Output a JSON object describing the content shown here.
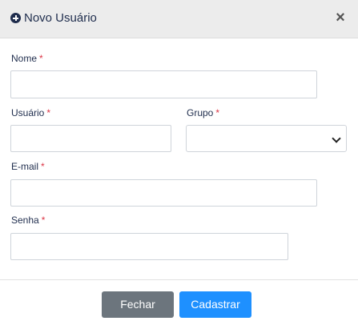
{
  "modal": {
    "title": "Novo Usuário",
    "close_symbol": "×",
    "icon": "plus-circle-icon"
  },
  "form": {
    "required_mark": "*",
    "name": {
      "label": "Nome",
      "value": ""
    },
    "username": {
      "label": "Usuário",
      "value": ""
    },
    "group": {
      "label": "Grupo",
      "selected": ""
    },
    "email": {
      "label": "E-mail",
      "value": ""
    },
    "password": {
      "label": "Senha",
      "value": ""
    }
  },
  "footer": {
    "close_label": "Fechar",
    "submit_label": "Cadastrar"
  },
  "colors": {
    "header_bg": "#ececec",
    "title": "#1f2d4d",
    "required": "#dc3545",
    "close_button": "#6c757d",
    "submit_button": "#1e90ff"
  }
}
